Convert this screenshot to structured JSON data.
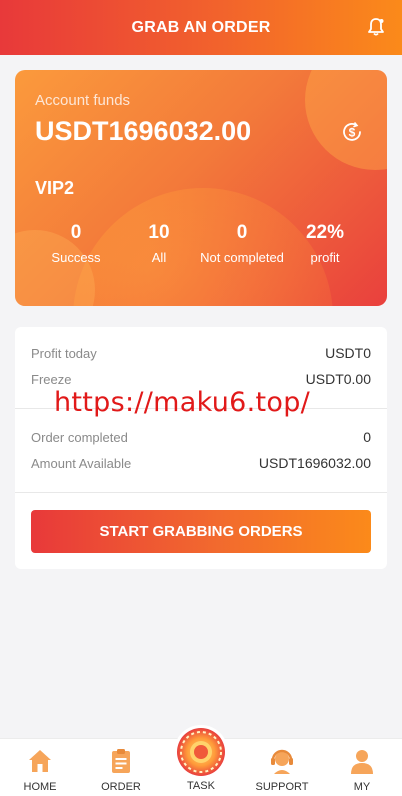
{
  "header": {
    "title": "GRAB AN ORDER",
    "bell_icon": "bell-icon"
  },
  "account": {
    "funds_label": "Account funds",
    "funds_value": "USDT1696032.00",
    "currency_icon": "dollar-refresh-icon",
    "vip_level": "VIP2",
    "stats": [
      {
        "value": "0",
        "label": "Success"
      },
      {
        "value": "10",
        "label": "All"
      },
      {
        "value": "0",
        "label": "Not completed"
      },
      {
        "value": "22%",
        "label": "profit"
      }
    ]
  },
  "summary": {
    "profit_today_label": "Profit today",
    "profit_today_value": "USDT0",
    "freeze_label": "Freeze",
    "freeze_value": "USDT0.00",
    "watermark": "https://maku6.top/",
    "order_completed_label": "Order completed",
    "order_completed_value": "0",
    "amount_available_label": "Amount Available",
    "amount_available_value": "USDT1696032.00",
    "grab_button": "START GRABBING ORDERS"
  },
  "tabbar": {
    "items": [
      {
        "label": "HOME",
        "icon": "home-icon"
      },
      {
        "label": "ORDER",
        "icon": "clipboard-icon"
      },
      {
        "label": "TASK",
        "icon": "task-wheel-icon"
      },
      {
        "label": "SUPPORT",
        "icon": "support-agent-icon"
      },
      {
        "label": "MY",
        "icon": "user-icon"
      }
    ]
  },
  "colors": {
    "accent_start": "#e8393a",
    "accent_end": "#fb8a1a",
    "watermark": "#e11919"
  }
}
